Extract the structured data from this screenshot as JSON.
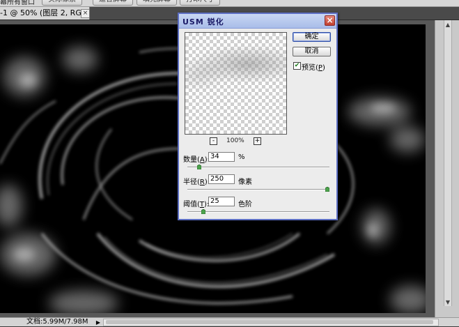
{
  "options_bar": {
    "label": "幕所有窗口",
    "buttons": [
      "实际像素",
      "适合屏幕",
      "填充屏幕",
      "打印尺寸"
    ]
  },
  "document_tab": {
    "title": "-1 @ 50% (图层 2, RGB/8) *",
    "close": "×"
  },
  "status_bar": {
    "doc_info": "文档:5.99M/7.98M",
    "arrow": "▶"
  },
  "dialog": {
    "title": "USM 锐化",
    "close": "×",
    "ok_label": "确定",
    "cancel_label": "取消",
    "preview_checked": true,
    "preview_label": "预览(",
    "preview_key": "P",
    "preview_suffix": ")",
    "zoom_out": "-",
    "zoom_in": "+",
    "zoom_level": "100%",
    "amount": {
      "label": "数量(",
      "key": "A",
      "suffix": "):",
      "value": "34",
      "unit": "%",
      "slider": 0.07
    },
    "radius": {
      "label": "半径(",
      "key": "R",
      "suffix": "):",
      "value": "250",
      "unit": "像素",
      "slider": 1.0
    },
    "threshold": {
      "label": "阈值(",
      "key": "T",
      "suffix": "):",
      "value": "25",
      "unit": "色阶",
      "slider": 0.1
    }
  },
  "colors": {
    "dialog_border": "#5d6fc4",
    "titlebar": "#a9bde9",
    "close_button": "#c2402e",
    "artwork_bg": "#000000"
  }
}
